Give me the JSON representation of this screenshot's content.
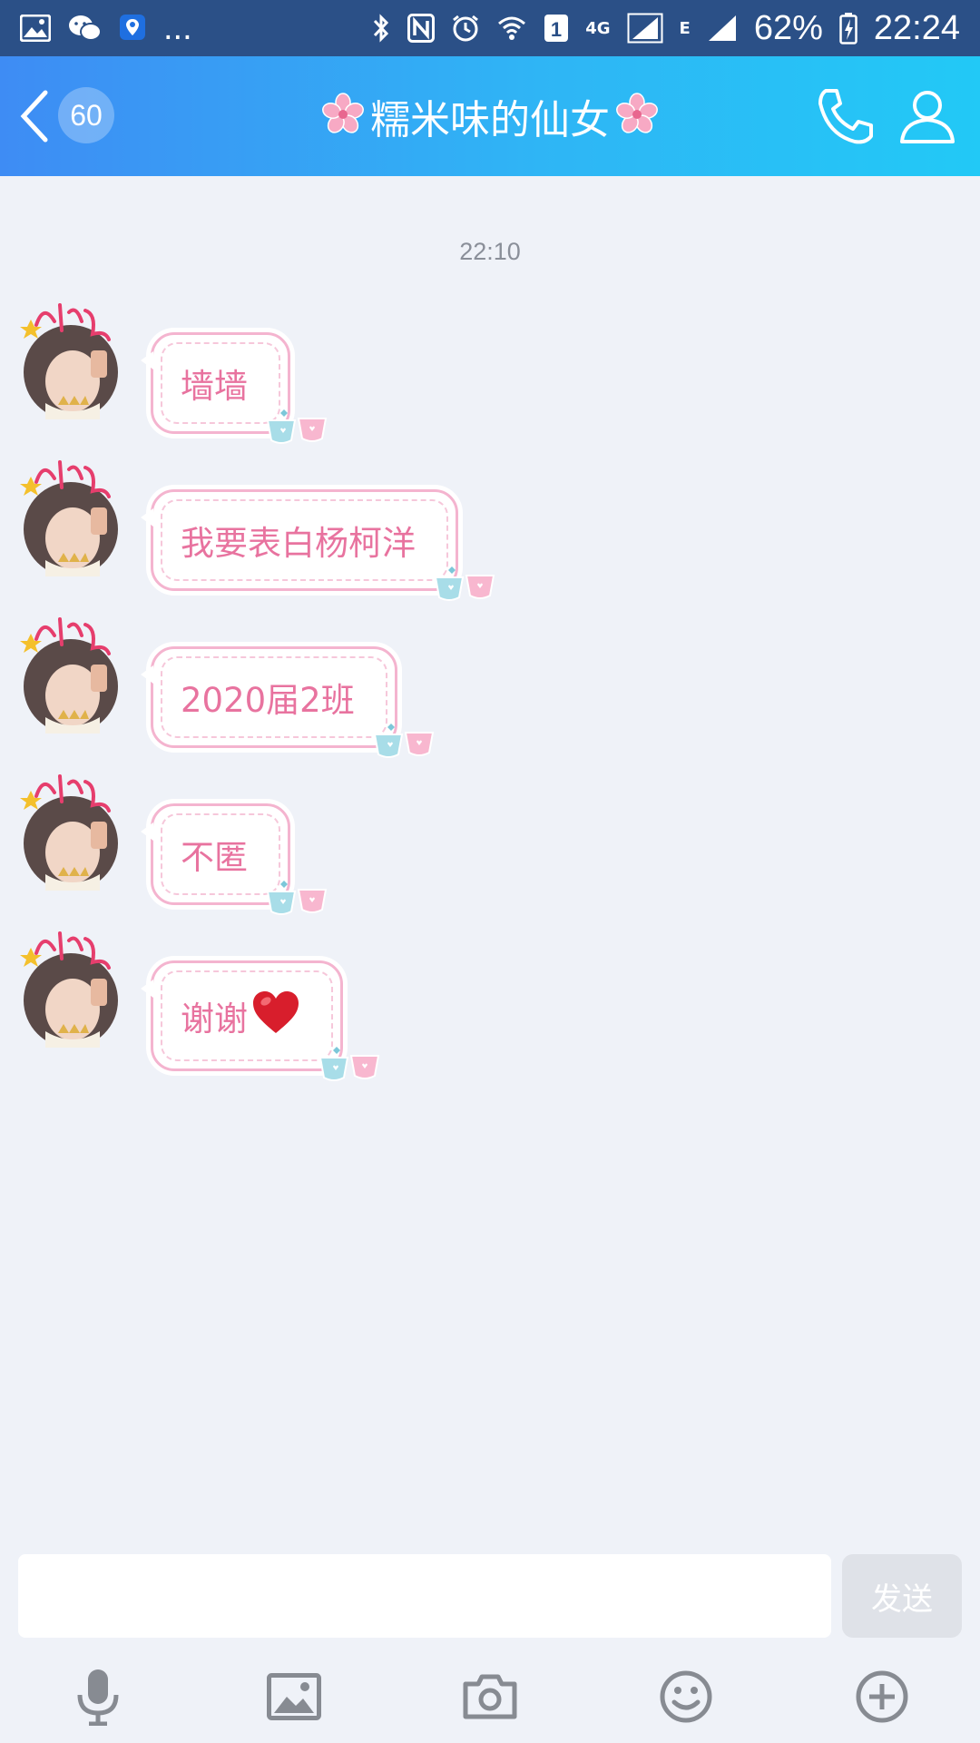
{
  "status_bar": {
    "overflow": "...",
    "network_4g": "4G",
    "network_e": "E",
    "sim_slot": "1",
    "battery": "62%",
    "time": "22:24"
  },
  "header": {
    "unread_count": "60",
    "title": "糯米味的仙女"
  },
  "chat": {
    "timestamp": "22:10",
    "messages": [
      {
        "text": "墙墙"
      },
      {
        "text": "我要表白杨柯洋"
      },
      {
        "text": "2020届2班"
      },
      {
        "text": "不匿"
      },
      {
        "text": "谢谢"
      }
    ]
  },
  "input": {
    "value": "",
    "placeholder": "",
    "send_label": "发送"
  },
  "colors": {
    "header_start": "#3e8cf4",
    "header_end": "#22c9f6",
    "bubble_text": "#e8739f",
    "bubble_border": "#f4b4cf"
  },
  "icons": [
    "image-icon",
    "wechat-icon",
    "location-icon",
    "bluetooth-icon",
    "nfc-icon",
    "alarm-icon",
    "wifi-icon",
    "signal-icon",
    "battery-icon",
    "back-icon",
    "cherry-blossom-icon",
    "phone-icon",
    "profile-icon",
    "heart-emoji",
    "cups-decoration-icon",
    "microphone-icon",
    "photo-icon",
    "camera-icon",
    "emoji-icon",
    "plus-icon"
  ]
}
